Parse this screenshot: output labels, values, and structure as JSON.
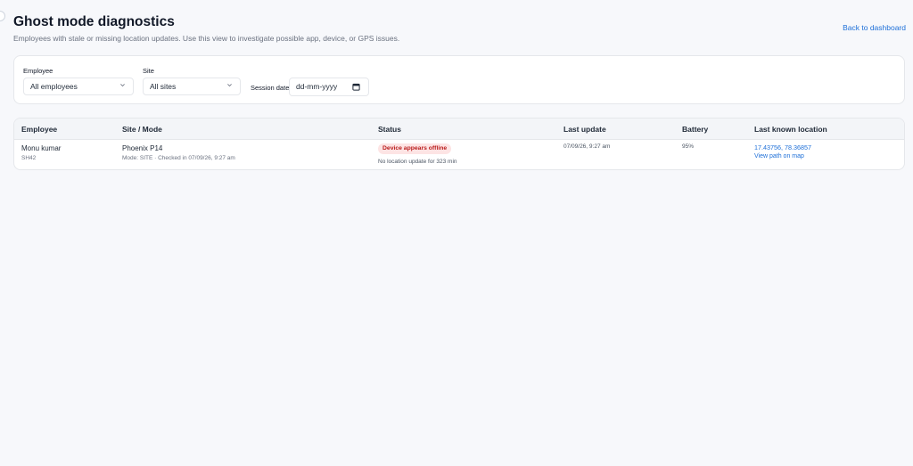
{
  "header": {
    "title": "Ghost mode diagnostics",
    "subtitle": "Employees with stale or missing location updates. Use this view to investigate possible app, device, or GPS issues.",
    "back_link": "Back to dashboard"
  },
  "filters": {
    "employee_label": "Employee",
    "employee_value": "All employees",
    "site_label": "Site",
    "site_value": "All sites",
    "session_date_label": "Session date",
    "session_date_placeholder": "dd-mm-yyyy"
  },
  "table": {
    "columns": [
      "Employee",
      "Site / Mode",
      "Status",
      "Last update",
      "Battery",
      "Last known location"
    ],
    "rows": [
      {
        "employee_name": "Monu kumar",
        "employee_id": "SH42",
        "site": "Phoenix P14",
        "mode_info": "Mode: SITE · Checked in 07/09/26, 9:27 am",
        "status_badge": "Device appears offline",
        "status_detail": "No location update for 323 min",
        "last_update": "07/09/26, 9:27 am",
        "battery": "95%",
        "location": "17.43756, 78.36857",
        "map_link": "View path on map"
      }
    ]
  },
  "colors": {
    "accent": "#1d6fd8",
    "badge_bg": "#fde4e4",
    "badge_text": "#b91c1c",
    "background": "#f7f8fb"
  },
  "icons": {
    "chevron": "chevron-down-icon",
    "calendar": "calendar-icon"
  }
}
